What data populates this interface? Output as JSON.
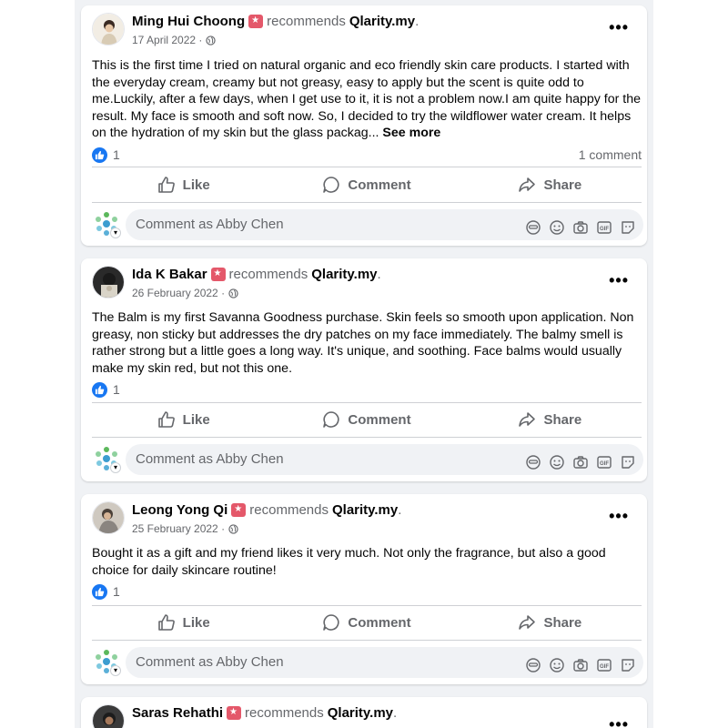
{
  "viewer": {
    "comment_placeholder": "Comment as Abby Chen"
  },
  "actions": {
    "like": "Like",
    "comment": "Comment",
    "share": "Share",
    "see_more": "See more"
  },
  "posts": [
    {
      "author": "Ming Hui Choong",
      "recommends": "recommends",
      "page": "Qlarity.my",
      "date": "17 April 2022",
      "text": "This is the first time I tried on natural organic and eco friendly skin care products. I started with the everyday cream, creamy but not greasy, easy to apply but the scent is quite odd to me.Luckily, after a few days, when I get use to it, it is not a problem now.I am quite happy for the result. My face is smooth and soft now. So, I decided to try the wildflower water cream.  It helps on the hydration of my skin but the glass packag...",
      "likes": "1",
      "comments": "1 comment"
    },
    {
      "author": "Ida K Bakar",
      "recommends": "recommends",
      "page": "Qlarity.my",
      "date": "26 February 2022",
      "text": "The Balm is my first Savanna Goodness purchase. Skin feels so smooth upon application. Non greasy, non sticky but addresses the dry patches on my face immediately. The balmy smell is rather strong but a little goes a long way. It's unique, and soothing. Face balms would usually make my skin red, but not this one.",
      "likes": "1"
    },
    {
      "author": "Leong Yong Qi",
      "recommends": "recommends",
      "page": "Qlarity.my",
      "date": "25 February 2022",
      "text": "Bought it as a gift and my friend likes it very much. Not only the fragrance, but also a good choice for daily skincare routine!",
      "likes": "1"
    },
    {
      "author": "Saras Rehathi",
      "recommends": "recommends",
      "page": "Qlarity.my"
    }
  ]
}
